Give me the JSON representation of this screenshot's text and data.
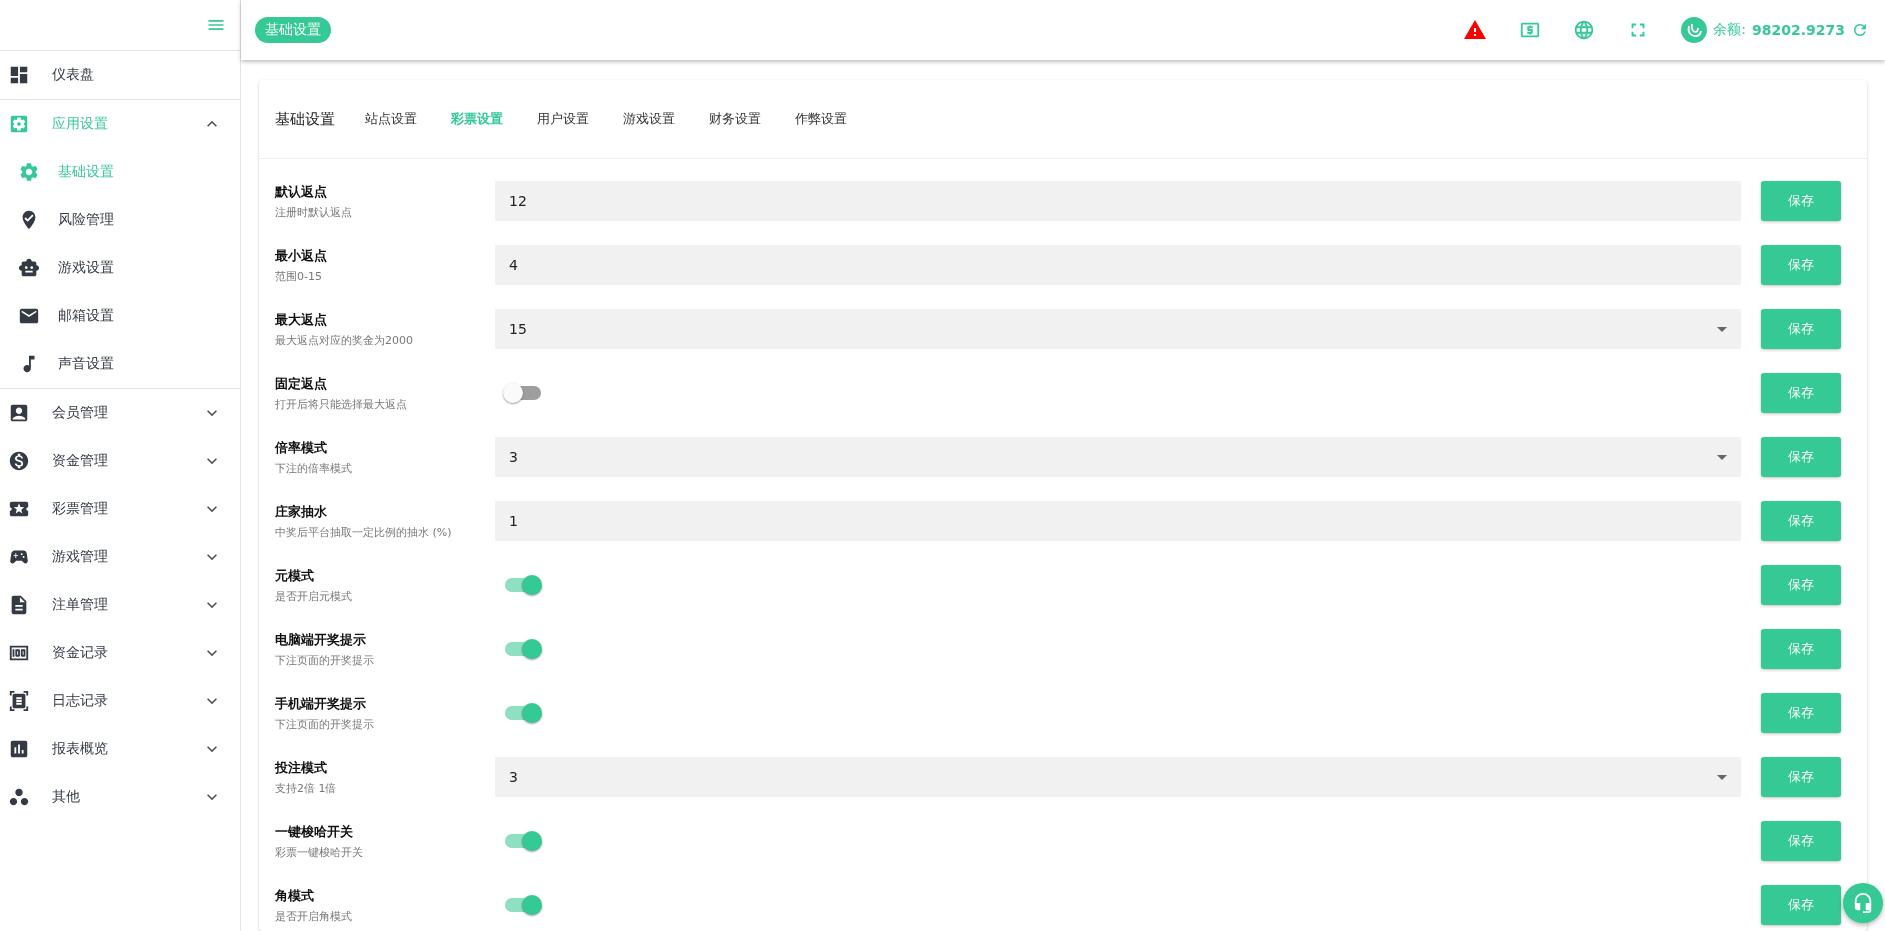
{
  "header": {
    "breadcrumb": "基础设置",
    "balance_label": "余额:",
    "balance_value": "98202.9273"
  },
  "sidebar": {
    "items": [
      {
        "label": "仪表盘",
        "selected": false
      },
      {
        "label": "应用设置",
        "expanded": true,
        "selected": true,
        "children": [
          {
            "label": "基础设置",
            "selected": true
          },
          {
            "label": "风险管理",
            "selected": false
          },
          {
            "label": "游戏设置",
            "selected": false
          },
          {
            "label": "邮箱设置",
            "selected": false
          },
          {
            "label": "声音设置",
            "selected": false
          }
        ]
      },
      {
        "label": "会员管理",
        "expanded": false,
        "selected": false
      },
      {
        "label": "资金管理",
        "expanded": false,
        "selected": false
      },
      {
        "label": "彩票管理",
        "expanded": false,
        "selected": false
      },
      {
        "label": "游戏管理",
        "expanded": false,
        "selected": false
      },
      {
        "label": "注单管理",
        "expanded": false,
        "selected": false
      },
      {
        "label": "资金记录",
        "expanded": false,
        "selected": false
      },
      {
        "label": "日志记录",
        "expanded": false,
        "selected": false
      },
      {
        "label": "报表概览",
        "expanded": false,
        "selected": false
      },
      {
        "label": "其他",
        "expanded": false,
        "selected": false
      }
    ]
  },
  "card": {
    "title": "基础设置",
    "tabs": [
      {
        "label": "站点设置",
        "selected": false
      },
      {
        "label": "彩票设置",
        "selected": true
      },
      {
        "label": "用户设置",
        "selected": false
      },
      {
        "label": "游戏设置",
        "selected": false
      },
      {
        "label": "财务设置",
        "selected": false
      },
      {
        "label": "作弊设置",
        "selected": false
      }
    ]
  },
  "settings": [
    {
      "kind": "input",
      "label": "默认返点",
      "hint": "注册时默认返点",
      "value": "12",
      "button": "保存"
    },
    {
      "kind": "input",
      "label": "最小返点",
      "hint": "范围0-15",
      "value": "4",
      "button": "保存"
    },
    {
      "kind": "select",
      "label": "最大返点",
      "hint": "最大返点对应的奖金为2000",
      "value": "15",
      "button": "保存"
    },
    {
      "kind": "switch",
      "label": "固定返点",
      "hint": "打开后将只能选择最大返点",
      "on": false,
      "button": "保存"
    },
    {
      "kind": "select",
      "label": "倍率模式",
      "hint": "下注的倍率模式",
      "value": "3",
      "button": "保存"
    },
    {
      "kind": "input",
      "label": "庄家抽水",
      "hint": "中奖后平台抽取一定比例的抽水 (%)",
      "value": "1",
      "button": "保存"
    },
    {
      "kind": "switch",
      "label": "元模式",
      "hint": "是否开启元模式",
      "on": true,
      "button": "保存"
    },
    {
      "kind": "switch",
      "label": "电脑端开奖提示",
      "hint": "下注页面的开奖提示",
      "on": true,
      "button": "保存"
    },
    {
      "kind": "switch",
      "label": "手机端开奖提示",
      "hint": "下注页面的开奖提示",
      "on": true,
      "button": "保存"
    },
    {
      "kind": "select",
      "label": "投注模式",
      "hint": "支持2倍 1倍",
      "value": "3",
      "button": "保存"
    },
    {
      "kind": "switch",
      "label": "一键梭哈开关",
      "hint": "彩票一键梭哈开关",
      "on": true,
      "button": "保存"
    },
    {
      "kind": "switch",
      "label": "角模式",
      "hint": "是否开启角模式",
      "on": true,
      "button": "保存"
    }
  ]
}
